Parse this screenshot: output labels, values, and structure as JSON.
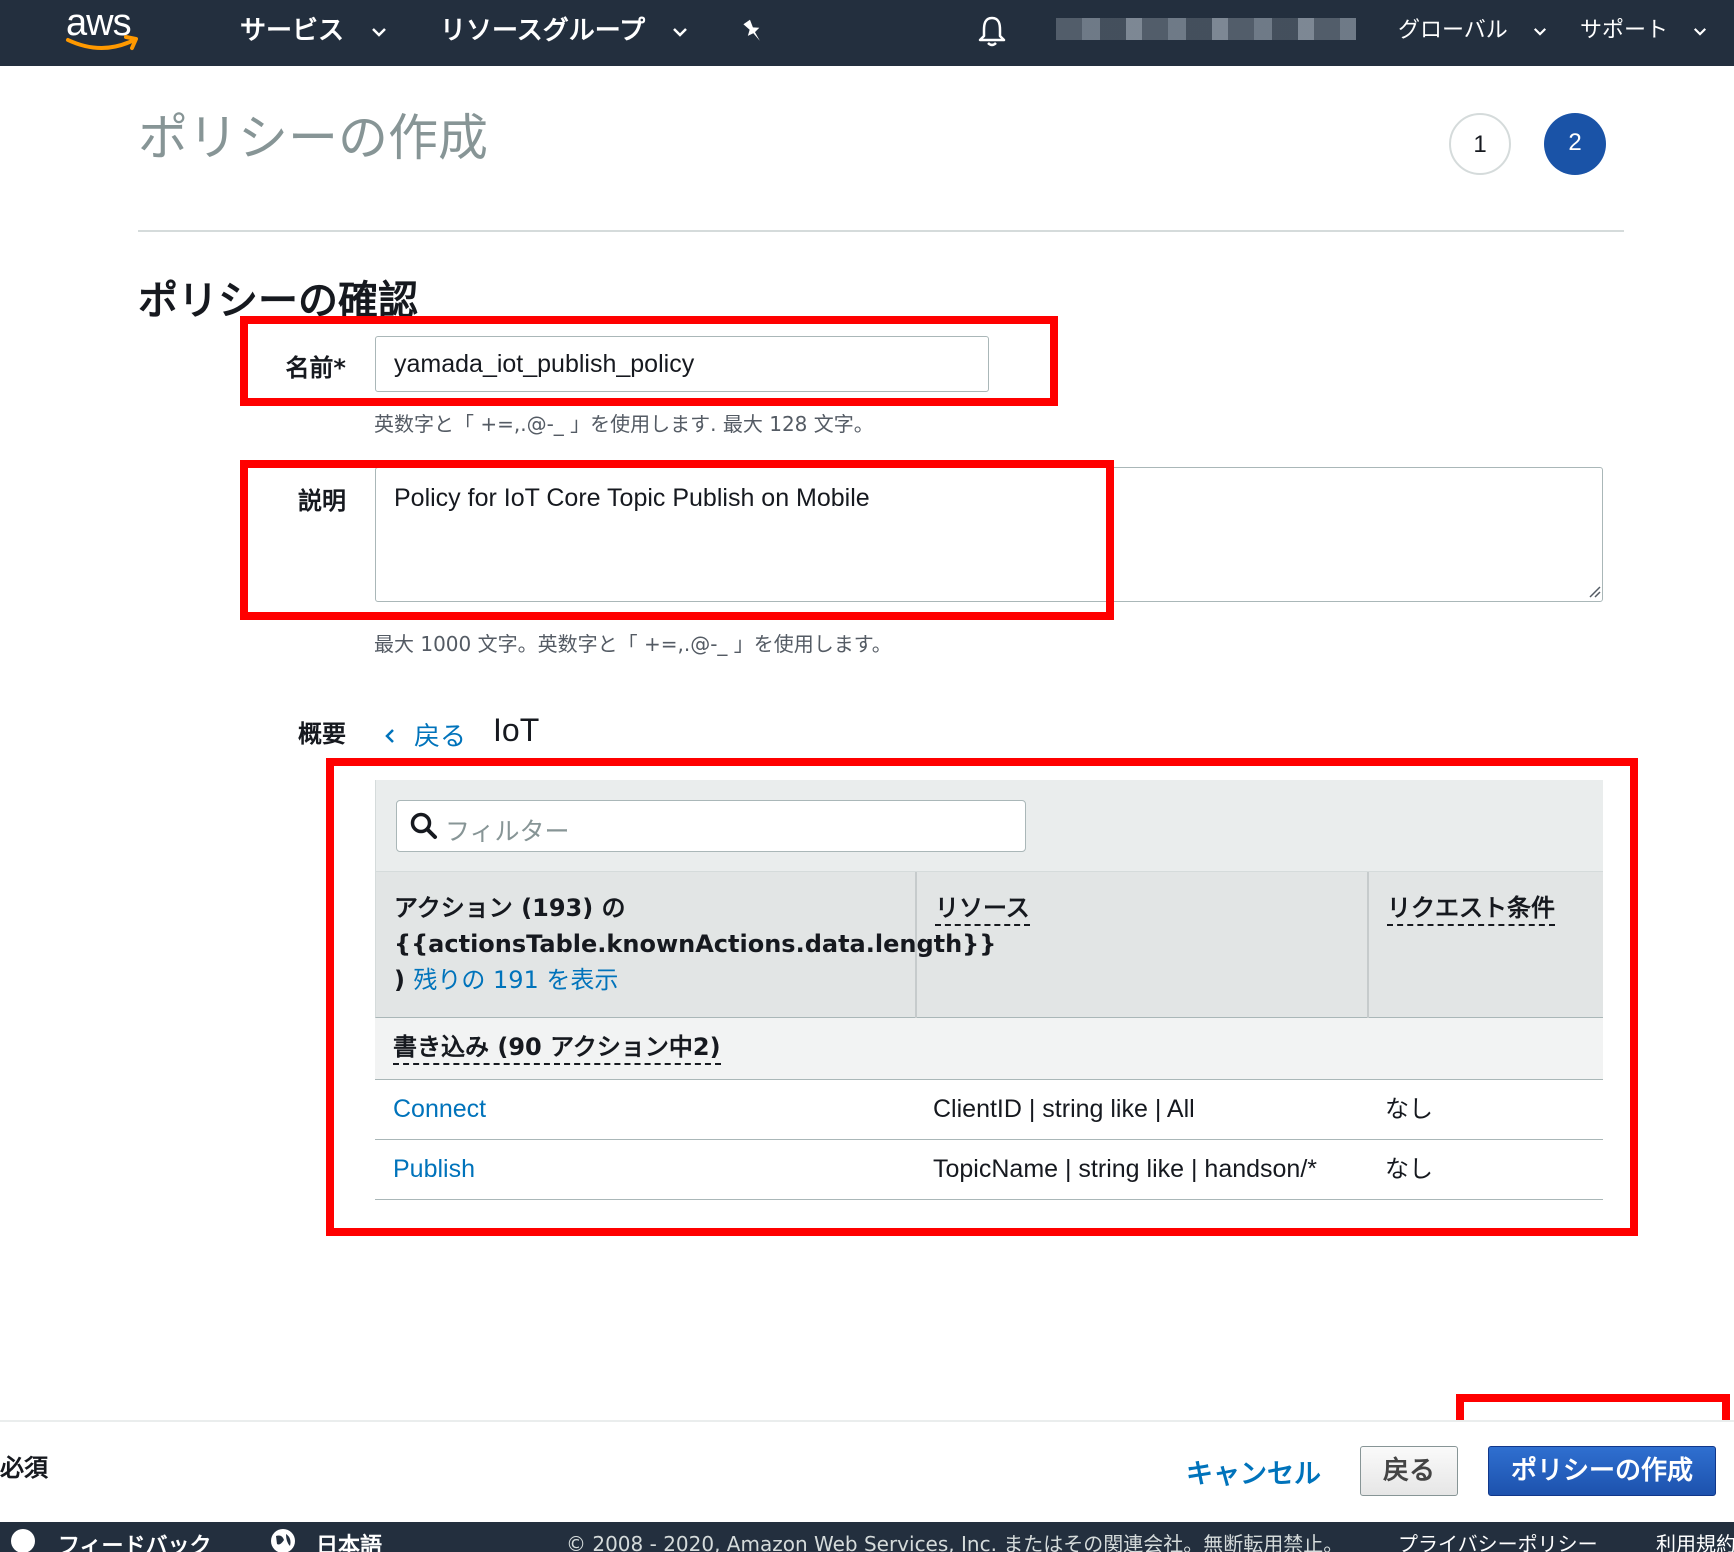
{
  "nav": {
    "logo_text": "aws",
    "services": "サービス",
    "resource_groups": "リソースグループ",
    "region": "グローバル",
    "support": "サポート"
  },
  "page": {
    "title": "ポリシーの作成",
    "steps": [
      "1",
      "2"
    ],
    "active_step": "2",
    "section_title": "ポリシーの確認"
  },
  "form": {
    "name_label": "名前*",
    "name_value": "yamada_iot_publish_policy",
    "name_hint": "英数字と「 +=,.@-_ 」を使用します. 最大 128 文字。",
    "description_label": "説明",
    "description_value": "Policy for IoT Core Topic Publish on Mobile",
    "description_hint": "最大 1000 文字。英数字と「 +=,.@-_ 」を使用します。",
    "summary_label": "概要",
    "back_link": "戻る",
    "service_name": "IoT"
  },
  "table": {
    "filter_placeholder": "フィルター",
    "header_action_line1": "アクション (193) の",
    "header_action_line2": "{{actionsTable.knownActions.data.length}}",
    "header_action_line3_prefix": ")",
    "header_action_show_rest": "残りの 191 を表示",
    "header_resource": "リソース",
    "header_condition": "リクエスト条件",
    "group_label": "書き込み (90 アクション中2)",
    "rows": [
      {
        "action": "Connect",
        "resource": "ClientID | string like | All",
        "condition": "なし"
      },
      {
        "action": "Publish",
        "resource": "TopicName | string like | handson/*",
        "condition": "なし"
      }
    ]
  },
  "actions": {
    "required": "必須",
    "cancel": "キャンセル",
    "back": "戻る",
    "create": "ポリシーの作成"
  },
  "footer": {
    "feedback": "フィードバック",
    "language": "日本語",
    "copyright": "© 2008 - 2020, Amazon Web Services, Inc. またはその関連会社。無断転用禁止。",
    "privacy": "プライバシーポリシー",
    "terms": "利用規約"
  },
  "colors": {
    "nav_bg": "#232f3e",
    "link": "#0073bb",
    "primary_button": "#1d52ad",
    "highlight": "#ff0000",
    "step_active": "#1a53a7"
  }
}
